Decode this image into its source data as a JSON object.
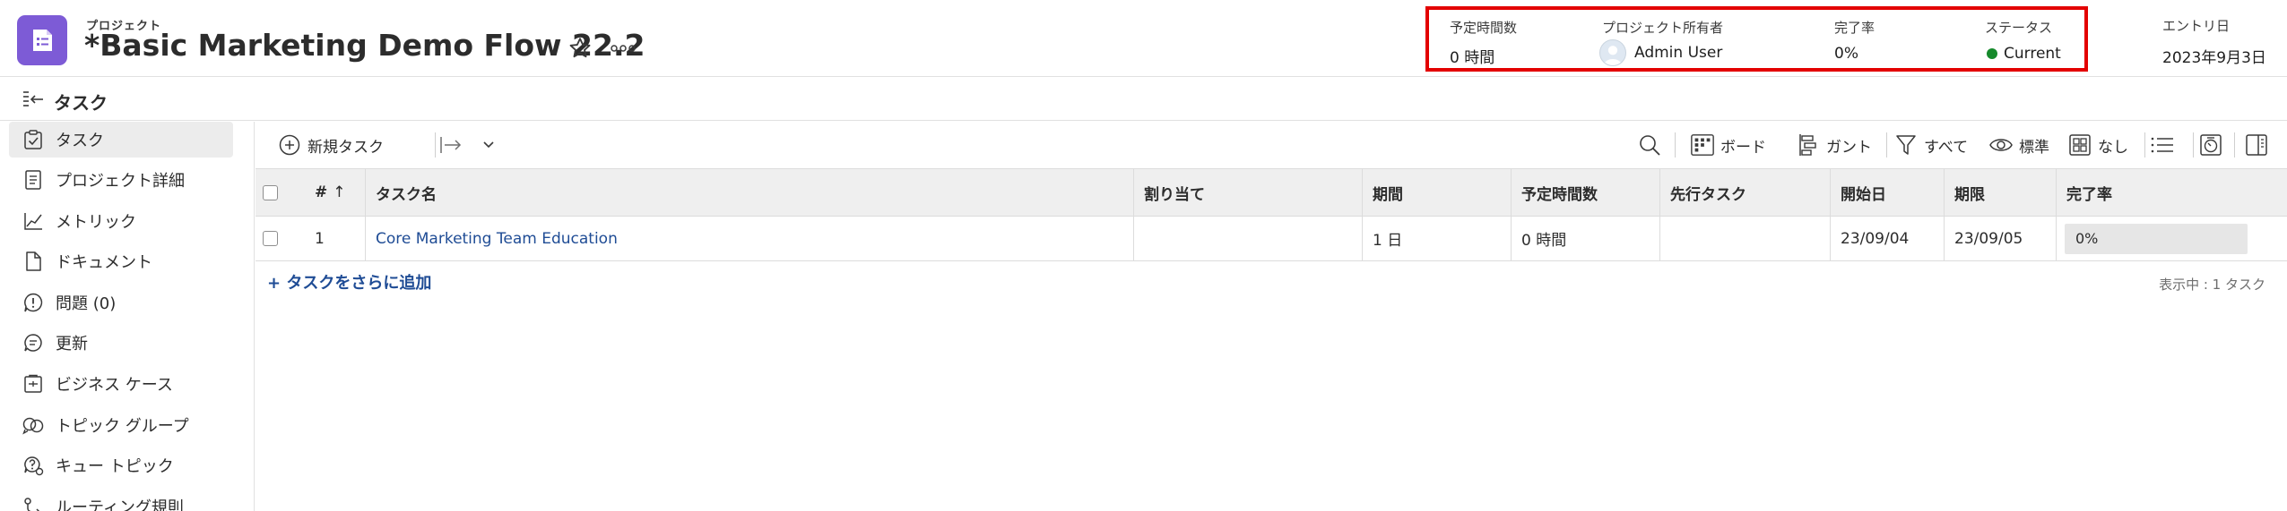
{
  "project": {
    "kicker": "プロジェクト",
    "title": "*Basic Marketing Demo Flow 22.2"
  },
  "summary": {
    "planned_hours": {
      "label": "予定時間数",
      "value": "0 時間"
    },
    "owner": {
      "label": "プロジェクト所有者",
      "value": "Admin User"
    },
    "percent_complete": {
      "label": "完了率",
      "value": "0%"
    },
    "status": {
      "label": "ステータス",
      "value": "Current",
      "color": "#168a2c"
    }
  },
  "entry": {
    "label": "エントリ日",
    "value": "2023年9月3日"
  },
  "subheader": {
    "title": "タスク"
  },
  "sidebar": {
    "items": [
      {
        "label": "タスク",
        "icon": "task-check-icon",
        "active": true
      },
      {
        "label": "プロジェクト詳細",
        "icon": "document-details-icon"
      },
      {
        "label": "メトリック",
        "icon": "metrics-chart-icon"
      },
      {
        "label": "ドキュメント",
        "icon": "document-icon"
      },
      {
        "label": "問題 (0)",
        "icon": "issue-icon"
      },
      {
        "label": "更新",
        "icon": "comment-icon"
      },
      {
        "label": "ビジネス ケース",
        "icon": "business-case-icon"
      },
      {
        "label": "トピック グループ",
        "icon": "topic-group-icon"
      },
      {
        "label": "キュー トピック",
        "icon": "queue-topic-icon"
      },
      {
        "label": "ルーティング規則",
        "icon": "routing-rule-icon"
      }
    ]
  },
  "toolbar": {
    "new_task": "新規タスク",
    "board": "ボード",
    "gantt": "ガント",
    "filter": "すべて",
    "view": "標準",
    "grouping": "なし"
  },
  "grid": {
    "headers": {
      "num": "#",
      "name": "タスク名",
      "assign": "割り当て",
      "duration": "期間",
      "planned": "予定時間数",
      "predecessor": "先行タスク",
      "start": "開始日",
      "due": "期限",
      "pct": "完了率"
    },
    "rows": [
      {
        "num": "1",
        "name": "Core Marketing Team Education",
        "assign": "",
        "duration": "1 日",
        "planned": "0 時間",
        "predecessor": "",
        "start": "23/09/04",
        "due": "23/09/05",
        "pct": "0%"
      }
    ]
  },
  "footer": {
    "add_more": "+ タスクをさらに追加",
    "showing": "表示中 : 1 タスク"
  }
}
